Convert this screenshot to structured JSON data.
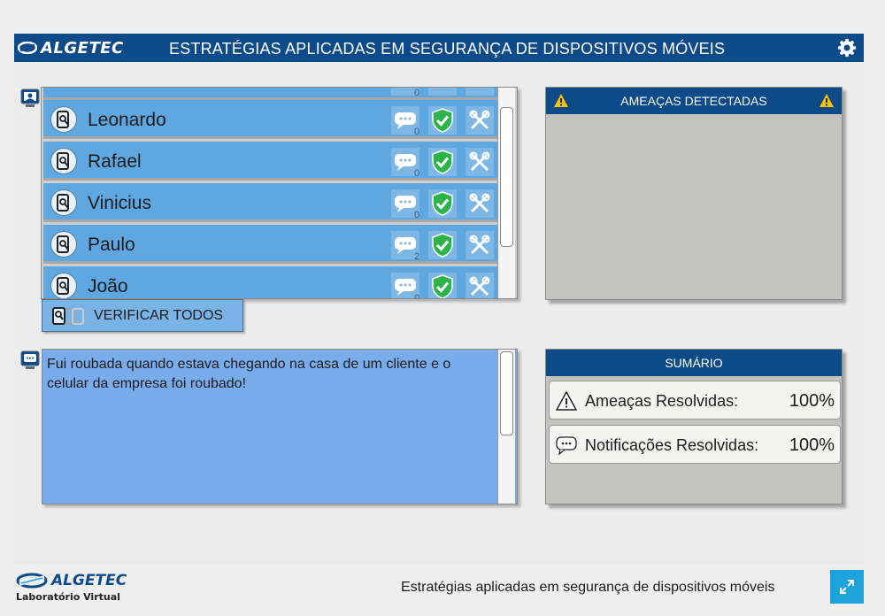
{
  "header": {
    "brand": "ALGETEC",
    "title": "ESTRATÉGIAS APLICADAS EM SEGURANÇA DE DISPOSITIVOS MÓVEIS",
    "settings_icon": "gear-icon"
  },
  "users": {
    "partial_top_count": "0",
    "items": [
      {
        "name": "Leonardo",
        "messages": "0"
      },
      {
        "name": "Rafael",
        "messages": "0"
      },
      {
        "name": "Vinicius",
        "messages": "0"
      },
      {
        "name": "Paulo",
        "messages": "2"
      },
      {
        "name": "João",
        "messages": "0"
      }
    ],
    "verify_all_label": "VERIFICAR TODOS"
  },
  "message": {
    "text": "Fui roubada quando estava chegando na casa de um cliente e o celular da empresa foi roubado!"
  },
  "threats": {
    "title": "AMEAÇAS DETECTADAS"
  },
  "summary": {
    "title": "SUMÁRIO",
    "threats_label": "Ameaças Resolvidas:",
    "threats_value": "100%",
    "notifications_label": "Notificações Resolvidas:",
    "notifications_value": "100%"
  },
  "footer": {
    "brand": "ALGETEC",
    "subtitle": "Laboratório Virtual",
    "title": "Estratégias aplicadas em segurança de dispositivos móveis"
  },
  "colors": {
    "header_blue": "#0d4a8a",
    "row_blue": "#5ea7e0",
    "shield_green": "#2db34a",
    "accent_cyan": "#1da3dc"
  }
}
